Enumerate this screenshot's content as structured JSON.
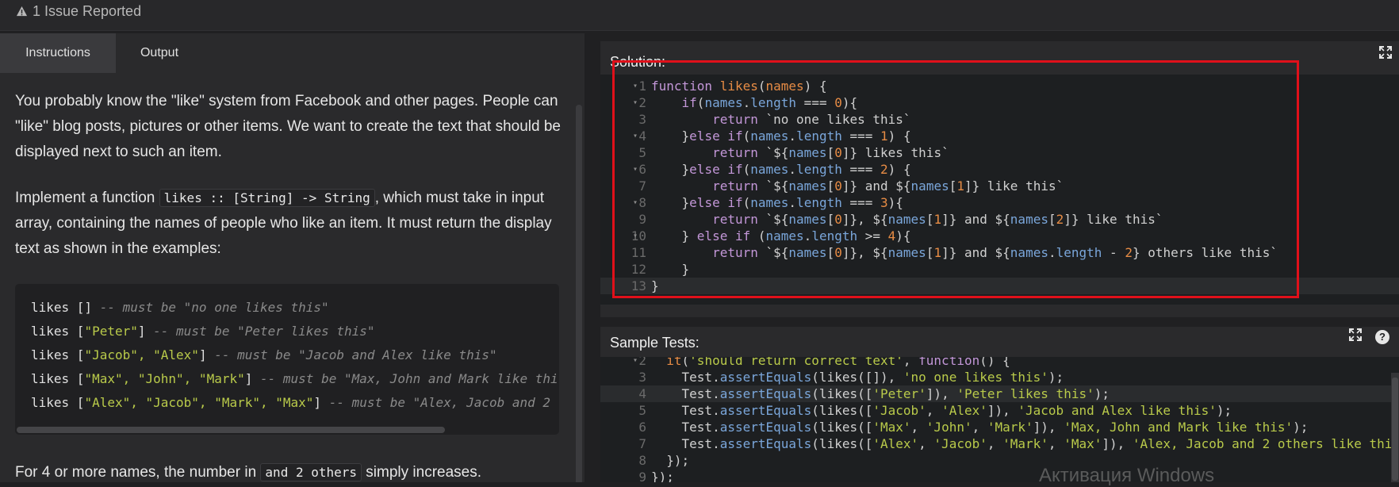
{
  "topbar": {
    "issue_text": "1 Issue Reported"
  },
  "tabs": {
    "instructions": "Instructions",
    "output": "Output"
  },
  "instructions": {
    "p1": "You probably know the \"like\" system from Facebook and other pages. People can \"like\" blog posts, pictures or other items. We want to create the text that should be displayed next to such an item.",
    "p2_before": "Implement a function ",
    "p2_code": "likes :: [String] -> String",
    "p2_after": ", which must take in input array, containing the names of people who like an item. It must return the display text as shown in the examples:",
    "examples": [
      {
        "code": "likes []",
        "strs": "",
        "comment": " -- must be \"no one likes this\""
      },
      {
        "code": "likes [",
        "strs": "\"Peter\"",
        "end": "]",
        "comment": " -- must be \"Peter likes this\""
      },
      {
        "code": "likes [",
        "strs": "\"Jacob\", \"Alex\"",
        "end": "]",
        "comment": " -- must be \"Jacob and Alex like this\""
      },
      {
        "code": "likes [",
        "strs": "\"Max\", \"John\", \"Mark\"",
        "end": "]",
        "comment": " -- must be \"Max, John and Mark like thi"
      },
      {
        "code": "likes [",
        "strs": "\"Alex\", \"Jacob\", \"Mark\", \"Max\"",
        "end": "]",
        "comment": " -- must be \"Alex, Jacob and 2"
      }
    ],
    "p3_before": "For 4 or more names, the number in ",
    "p3_code": "and 2 others",
    "p3_after": " simply increases."
  },
  "solution": {
    "title": "Solution:",
    "line_numbers": [
      "1",
      "2",
      "3",
      "4",
      "5",
      "6",
      "7",
      "8",
      "9",
      "10",
      "11",
      "12",
      "13"
    ]
  },
  "sample_tests": {
    "title": "Sample Tests:",
    "line_numbers": [
      "2",
      "3",
      "4",
      "5",
      "6",
      "7",
      "8",
      "9"
    ]
  },
  "watermark": "Активация Windows",
  "icons": {
    "warning": "warning-icon",
    "expand": "expand-icon",
    "help": "help-icon"
  }
}
